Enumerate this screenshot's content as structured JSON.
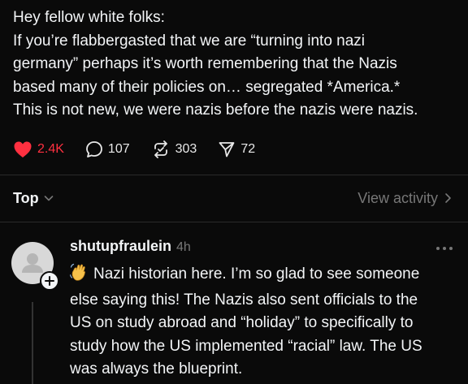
{
  "post": {
    "lines": [
      "Hey fellow white folks:",
      "If you’re flabbergasted that we are “turning into nazi",
      "germany” perhaps it’s worth remembering that the Nazis",
      "based many of their policies on… segregated *America.*",
      "This is not new, we were nazis before the nazis were nazis."
    ],
    "likes": "2.4K",
    "comments": "107",
    "reposts": "303",
    "shares": "72"
  },
  "sort": {
    "label": "Top",
    "view_activity": "View activity"
  },
  "reply": {
    "username": "shutupfraulein",
    "time": "4h",
    "lines": [
      "Nazi historian here. I’m so glad to see someone",
      "else saying this! The Nazis also sent officials to the",
      "US on study abroad and “holiday” to specifically to",
      "study how the US implemented “racial” law. The US",
      "was always the blueprint."
    ],
    "emoji": "waving-hand-icon"
  },
  "colors": {
    "background": "#0a0a0a",
    "text": "#f3f5f7",
    "like": "#ff3040",
    "muted": "#777777"
  }
}
